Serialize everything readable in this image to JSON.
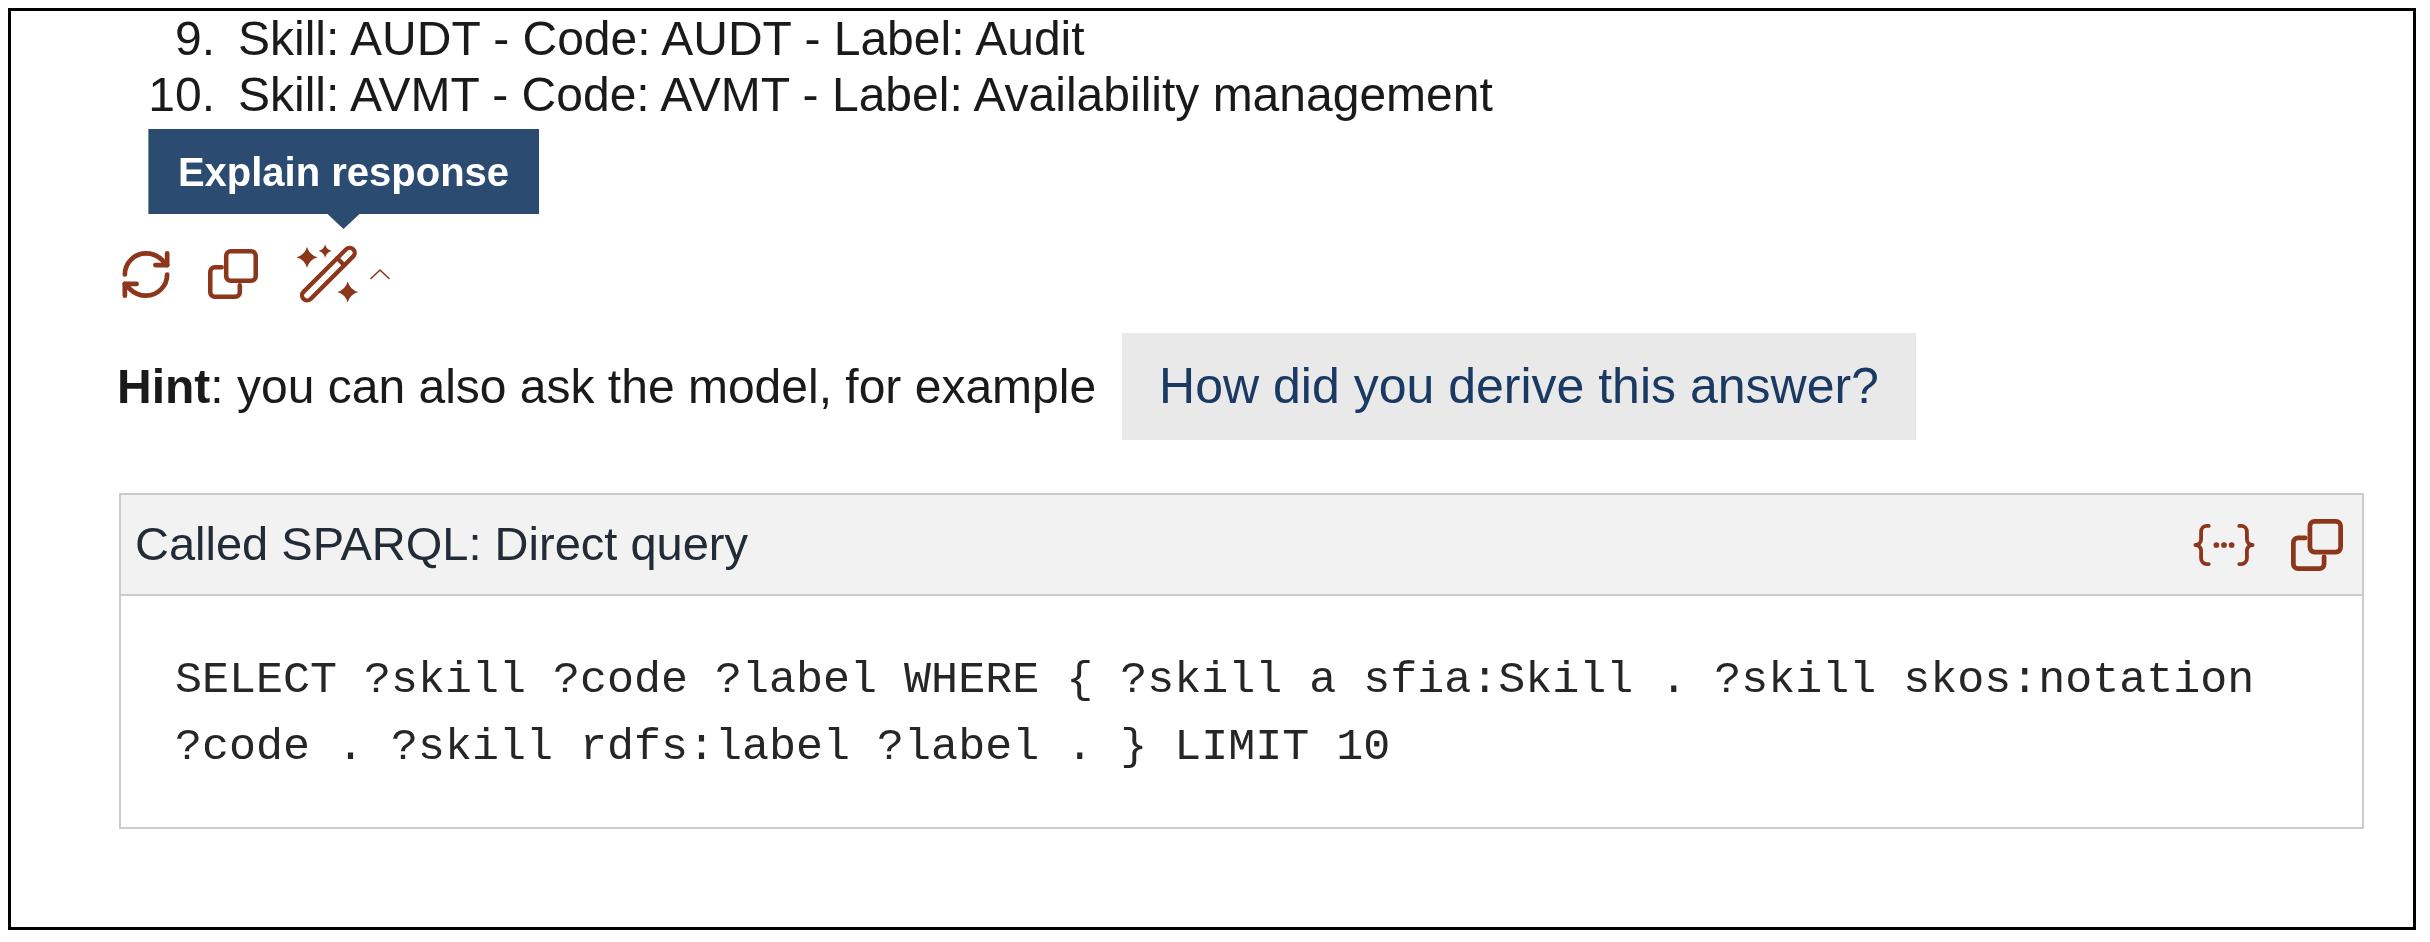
{
  "answer_list": [
    {
      "number": "9.",
      "text": "Skill: AUDT - Code: AUDT - Label: Audit"
    },
    {
      "number": "10.",
      "text": "Skill: AVMT - Code: AVMT - Label: Availability management"
    }
  ],
  "response_actions": [
    {
      "kind": "refresh"
    },
    {
      "kind": "copy"
    },
    {
      "kind": "explain",
      "tooltip": "Explain response"
    }
  ],
  "hint": {
    "text": "**Hint**: you can also ask the model, for example",
    "suggestion": "How did you derive this answer?"
  },
  "tool_call": {
    "title": "Called SPARQL: Direct query",
    "actions": [
      {
        "kind": "code"
      },
      {
        "kind": "copy"
      }
    ],
    "query": "SELECT ?skill ?code ?label WHERE { ?skill a sfia:Skill . ?skill skos:notation ?code . ?skill rdfs:label ?label . } LIMIT 10"
  }
}
